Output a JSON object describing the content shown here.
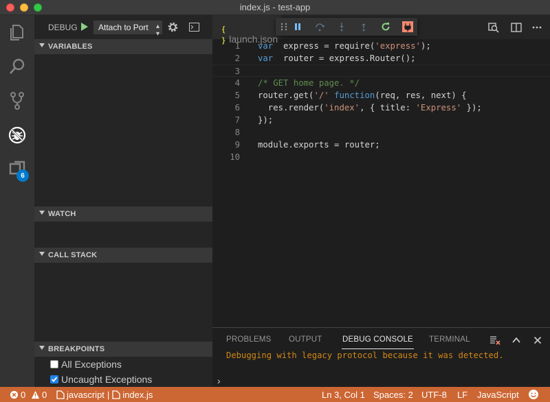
{
  "window": {
    "title": "index.js - test-app"
  },
  "activity_bar": {
    "extensions_badge": "6"
  },
  "sidebar": {
    "debug_label": "DEBUG",
    "configuration": "Attach to Port",
    "sections": {
      "variables": "VARIABLES",
      "watch": "WATCH",
      "call_stack": "CALL STACK",
      "breakpoints": "BREAKPOINTS"
    },
    "breakpoints": [
      {
        "label": "All Exceptions",
        "checked": false
      },
      {
        "label": "Uncaught Exceptions",
        "checked": true
      }
    ]
  },
  "editor": {
    "tab_label": "launch.json",
    "tab_icon": "{ }",
    "lines": [
      {
        "n": "1",
        "tokens": [
          [
            "kw",
            "var"
          ],
          [
            "",
            "  express = require("
          ],
          [
            "str",
            "'express'"
          ],
          [
            "",
            ");"
          ]
        ]
      },
      {
        "n": "2",
        "tokens": [
          [
            "kw",
            "var"
          ],
          [
            "",
            "  router = express.Router();"
          ]
        ]
      },
      {
        "n": "3",
        "tokens": []
      },
      {
        "n": "4",
        "tokens": [
          [
            "com",
            "/* GET home page. */"
          ]
        ]
      },
      {
        "n": "5",
        "tokens": [
          [
            "",
            "router.get("
          ],
          [
            "str",
            "'/'"
          ],
          [
            ",",
            " "
          ],
          [
            "kw",
            "function"
          ],
          [
            "",
            "(req, res, next) {"
          ]
        ]
      },
      {
        "n": "6",
        "tokens": [
          [
            "",
            "  res.render("
          ],
          [
            "str",
            "'index'"
          ],
          [
            "",
            ", { title: "
          ],
          [
            "str",
            "'Express'"
          ],
          [
            "",
            " });"
          ]
        ]
      },
      {
        "n": "7",
        "tokens": [
          [
            "",
            "});"
          ]
        ]
      },
      {
        "n": "8",
        "tokens": []
      },
      {
        "n": "9",
        "tokens": [
          [
            "",
            "module.exports = router;"
          ]
        ]
      },
      {
        "n": "10",
        "tokens": []
      }
    ]
  },
  "panel": {
    "tabs": [
      "PROBLEMS",
      "OUTPUT",
      "DEBUG CONSOLE",
      "TERMINAL"
    ],
    "active_tab": "DEBUG CONSOLE",
    "message": "Debugging with legacy protocol because it was detected.",
    "prompt": "›"
  },
  "status_bar": {
    "errors": "0",
    "warnings": "0",
    "language_crumb": "javascript",
    "file_crumb": "index.js",
    "cursor": "Ln 3, Col 1",
    "spaces": "Spaces: 2",
    "encoding": "UTF-8",
    "eol": "LF",
    "language": "JavaScript"
  },
  "colors": {
    "status_bar_debug": "#cc6633",
    "accent": "#007acc",
    "warning_text": "#d18616"
  }
}
